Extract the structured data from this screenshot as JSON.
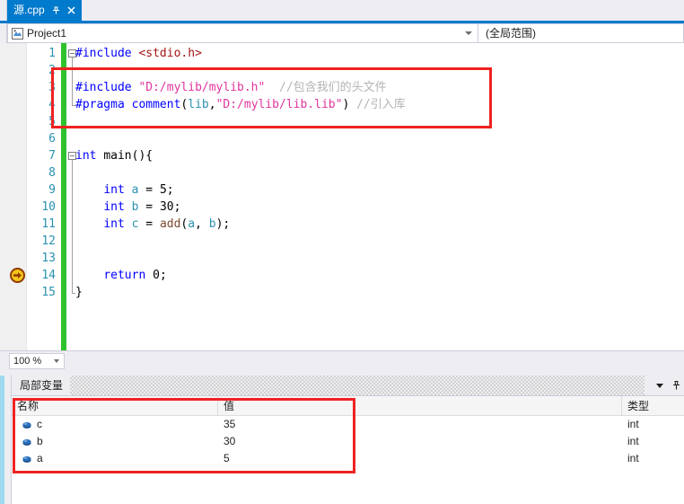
{
  "window": {
    "accent_color": "#007acc",
    "annotation_color": "#ee2222",
    "changebar_color": "#2fc22f"
  },
  "tabstrip": {
    "tabs": [
      {
        "label": "源.cpp",
        "pin_icon": "pin-icon",
        "close_icon": "close-icon",
        "active": true
      }
    ]
  },
  "navbar": {
    "project_icon": "project-icon",
    "scope": "Project1",
    "member": "(全局范围)",
    "dropdown_icon": "chevron-down-icon"
  },
  "editor": {
    "zoom_level": "100 %",
    "current_statement_line": 14,
    "lines": [
      {
        "number": "1",
        "fold": "collapse",
        "tokens": [
          {
            "t": "#include ",
            "c": "pp"
          },
          {
            "t": "<stdio.h>",
            "c": "angle"
          }
        ]
      },
      {
        "number": "2",
        "fold": "",
        "tokens": []
      },
      {
        "number": "3",
        "fold": "",
        "tokens": [
          {
            "t": "#include ",
            "c": "pp"
          },
          {
            "t": "\"D:/mylib/mylib.h\"",
            "c": "str"
          },
          {
            "t": "  ",
            "c": "punct"
          },
          {
            "t": "//包含我们的头文件",
            "c": "cmt"
          }
        ]
      },
      {
        "number": "4",
        "fold": "",
        "tokens": [
          {
            "t": "#pragma ",
            "c": "pp"
          },
          {
            "t": "comment",
            "c": "pp"
          },
          {
            "t": "(",
            "c": "punct"
          },
          {
            "t": "lib",
            "c": "ident"
          },
          {
            "t": ",",
            "c": "punct"
          },
          {
            "t": "\"D:/mylib/lib.lib\"",
            "c": "str"
          },
          {
            "t": ") ",
            "c": "punct"
          },
          {
            "t": "//引入库",
            "c": "cmt"
          }
        ]
      },
      {
        "number": "5",
        "fold": "",
        "tokens": []
      },
      {
        "number": "6",
        "fold": "",
        "tokens": []
      },
      {
        "number": "7",
        "fold": "collapse",
        "tokens": [
          {
            "t": "int ",
            "c": "kw"
          },
          {
            "t": "main",
            "c": "num"
          },
          {
            "t": "(){",
            "c": "punct"
          }
        ]
      },
      {
        "number": "8",
        "fold": "",
        "tokens": []
      },
      {
        "number": "9",
        "fold": "",
        "tokens": [
          {
            "t": "    ",
            "c": "punct"
          },
          {
            "t": "int ",
            "c": "kw"
          },
          {
            "t": "a",
            "c": "ident"
          },
          {
            "t": " = ",
            "c": "punct"
          },
          {
            "t": "5",
            "c": "num"
          },
          {
            "t": ";",
            "c": "punct"
          }
        ]
      },
      {
        "number": "10",
        "fold": "",
        "tokens": [
          {
            "t": "    ",
            "c": "punct"
          },
          {
            "t": "int ",
            "c": "kw"
          },
          {
            "t": "b",
            "c": "ident"
          },
          {
            "t": " = ",
            "c": "punct"
          },
          {
            "t": "30",
            "c": "num"
          },
          {
            "t": ";",
            "c": "punct"
          }
        ]
      },
      {
        "number": "11",
        "fold": "",
        "tokens": [
          {
            "t": "    ",
            "c": "punct"
          },
          {
            "t": "int ",
            "c": "kw"
          },
          {
            "t": "c",
            "c": "ident"
          },
          {
            "t": " = ",
            "c": "punct"
          },
          {
            "t": "add",
            "c": "fn"
          },
          {
            "t": "(",
            "c": "punct"
          },
          {
            "t": "a",
            "c": "ident"
          },
          {
            "t": ", ",
            "c": "punct"
          },
          {
            "t": "b",
            "c": "ident"
          },
          {
            "t": ");",
            "c": "punct"
          }
        ]
      },
      {
        "number": "12",
        "fold": "",
        "tokens": []
      },
      {
        "number": "13",
        "fold": "",
        "tokens": []
      },
      {
        "number": "14",
        "fold": "",
        "tokens": [
          {
            "t": "    ",
            "c": "punct"
          },
          {
            "t": "return ",
            "c": "kw"
          },
          {
            "t": "0",
            "c": "num"
          },
          {
            "t": ";",
            "c": "punct"
          }
        ]
      },
      {
        "number": "15",
        "fold": "",
        "tokens": [
          {
            "t": "}",
            "c": "punct"
          }
        ]
      }
    ]
  },
  "locals": {
    "title": "局部变量",
    "columns": [
      "名称",
      "值",
      "类型"
    ],
    "rows": [
      {
        "icon": "variable-icon",
        "name": "c",
        "value": "35",
        "type": "int"
      },
      {
        "icon": "variable-icon",
        "name": "b",
        "value": "30",
        "type": "int"
      },
      {
        "icon": "variable-icon",
        "name": "a",
        "value": "5",
        "type": "int"
      }
    ],
    "dropdown_icon": "chevron-down-icon",
    "pin_icon": "pin-icon"
  }
}
